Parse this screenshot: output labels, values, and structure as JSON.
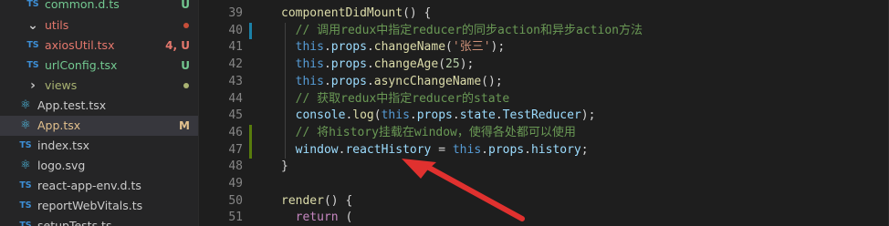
{
  "explorer": {
    "items": [
      {
        "icon": "TS",
        "label": "common.d.ts",
        "status": "U"
      },
      {
        "icon": "chevron-down",
        "label": "utils",
        "status": "dot"
      },
      {
        "icon": "TS",
        "label": "axiosUtil.tsx",
        "status": "4, U"
      },
      {
        "icon": "TS",
        "label": "urlConfig.tsx",
        "status": "U"
      },
      {
        "icon": "chevron-right",
        "label": "views",
        "status": "dot"
      },
      {
        "icon": "react",
        "label": "App.test.tsx",
        "status": ""
      },
      {
        "icon": "react",
        "label": "App.tsx",
        "status": "M"
      },
      {
        "icon": "TS",
        "label": "index.tsx",
        "status": ""
      },
      {
        "icon": "react",
        "label": "logo.svg",
        "status": ""
      },
      {
        "icon": "TS",
        "label": "react-app-env.d.ts",
        "status": ""
      },
      {
        "icon": "TS",
        "label": "reportWebVitals.ts",
        "status": ""
      },
      {
        "icon": "TS",
        "label": "setupTests.ts",
        "status": ""
      }
    ]
  },
  "editor": {
    "line_numbers": [
      "39",
      "40",
      "41",
      "42",
      "43",
      "44",
      "45",
      "46",
      "47",
      "48",
      "49",
      "50",
      "51"
    ],
    "lines": [
      [
        {
          "t": "componentDidMount",
          "c": "k-fn"
        },
        {
          "t": "() {",
          "c": "k-pun"
        }
      ],
      [
        {
          "t": "  // 调用redux中指定reducer的同步action和异步action方法",
          "c": "k-cm"
        }
      ],
      [
        {
          "t": "  this",
          "c": "k-kw"
        },
        {
          "t": ".",
          "c": "k-pun"
        },
        {
          "t": "props",
          "c": "k-var"
        },
        {
          "t": ".",
          "c": "k-pun"
        },
        {
          "t": "changeName",
          "c": "k-fn"
        },
        {
          "t": "(",
          "c": "k-pun"
        },
        {
          "t": "'张三'",
          "c": "k-str"
        },
        {
          "t": ");",
          "c": "k-pun"
        }
      ],
      [
        {
          "t": "  this",
          "c": "k-kw"
        },
        {
          "t": ".",
          "c": "k-pun"
        },
        {
          "t": "props",
          "c": "k-var"
        },
        {
          "t": ".",
          "c": "k-pun"
        },
        {
          "t": "changeAge",
          "c": "k-fn"
        },
        {
          "t": "(",
          "c": "k-pun"
        },
        {
          "t": "25",
          "c": "k-num"
        },
        {
          "t": ");",
          "c": "k-pun"
        }
      ],
      [
        {
          "t": "  this",
          "c": "k-kw"
        },
        {
          "t": ".",
          "c": "k-pun"
        },
        {
          "t": "props",
          "c": "k-var"
        },
        {
          "t": ".",
          "c": "k-pun"
        },
        {
          "t": "asyncChangeName",
          "c": "k-fn"
        },
        {
          "t": "();",
          "c": "k-pun"
        }
      ],
      [
        {
          "t": "  // 获取redux中指定reducer的state",
          "c": "k-cm"
        }
      ],
      [
        {
          "t": "  console",
          "c": "k-var"
        },
        {
          "t": ".",
          "c": "k-pun"
        },
        {
          "t": "log",
          "c": "k-fn"
        },
        {
          "t": "(",
          "c": "k-pun"
        },
        {
          "t": "this",
          "c": "k-kw"
        },
        {
          "t": ".",
          "c": "k-pun"
        },
        {
          "t": "props",
          "c": "k-var"
        },
        {
          "t": ".",
          "c": "k-pun"
        },
        {
          "t": "state",
          "c": "k-var"
        },
        {
          "t": ".",
          "c": "k-pun"
        },
        {
          "t": "TestReducer",
          "c": "k-var"
        },
        {
          "t": ");",
          "c": "k-pun"
        }
      ],
      [
        {
          "t": "  // 将history挂载在window，使得各处都可以使用",
          "c": "k-cm"
        }
      ],
      [
        {
          "t": "  window",
          "c": "k-var"
        },
        {
          "t": ".",
          "c": "k-pun"
        },
        {
          "t": "reactHistory",
          "c": "k-var"
        },
        {
          "t": " = ",
          "c": "k-pun"
        },
        {
          "t": "this",
          "c": "k-kw"
        },
        {
          "t": ".",
          "c": "k-pun"
        },
        {
          "t": "props",
          "c": "k-var"
        },
        {
          "t": ".",
          "c": "k-pun"
        },
        {
          "t": "history",
          "c": "k-var"
        },
        {
          "t": ";",
          "c": "k-pun"
        }
      ],
      [
        {
          "t": "}",
          "c": "k-pun"
        }
      ],
      [
        {
          "t": "",
          "c": "k-pun"
        }
      ],
      [
        {
          "t": "render",
          "c": "k-fn"
        },
        {
          "t": "() {",
          "c": "k-pun"
        }
      ],
      [
        {
          "t": "  return",
          "c": "k-ctl"
        },
        {
          "t": " (",
          "c": "k-pun"
        }
      ]
    ]
  },
  "annotation": {
    "color": "#e0312f"
  }
}
